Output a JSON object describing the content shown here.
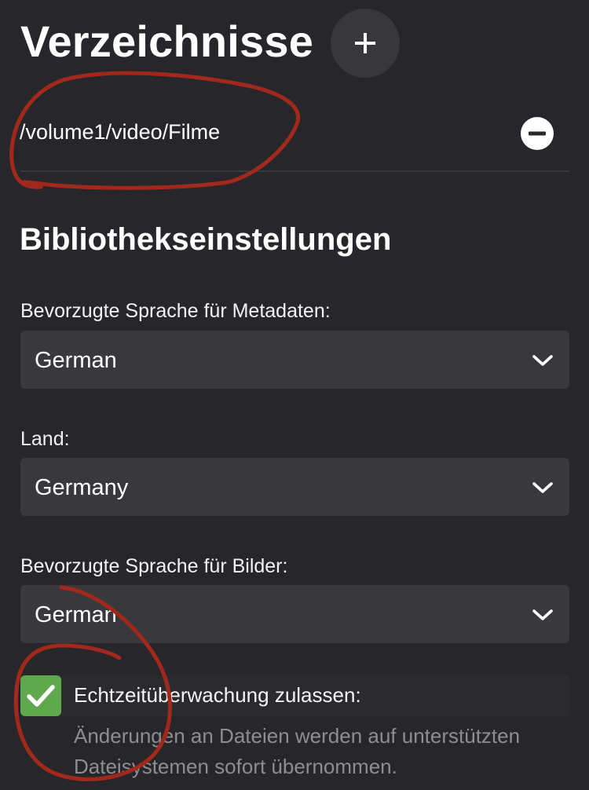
{
  "header": {
    "title": "Verzeichnisse",
    "add_icon": "plus-icon"
  },
  "folders": [
    {
      "path": "/volume1/video/Filme",
      "remove_icon": "minus-circle-icon"
    }
  ],
  "library_settings": {
    "heading": "Bibliothekseinstellungen",
    "metadata_language": {
      "label": "Bevorzugte Sprache für Metadaten:",
      "value": "German"
    },
    "country": {
      "label": "Land:",
      "value": "Germany"
    },
    "image_language": {
      "label": "Bevorzugte Sprache für Bilder:",
      "value": "German"
    },
    "realtime_monitoring": {
      "checked": true,
      "label": "Echtzeitüberwachung zulassen:",
      "description": "Änderungen an Dateien werden auf unterstützten Dateisystemen sofort übernommen."
    }
  },
  "colors": {
    "background": "#27272b",
    "control": "#38383d",
    "checkbox": "#5fa84e",
    "annotation": "#a3281c"
  }
}
